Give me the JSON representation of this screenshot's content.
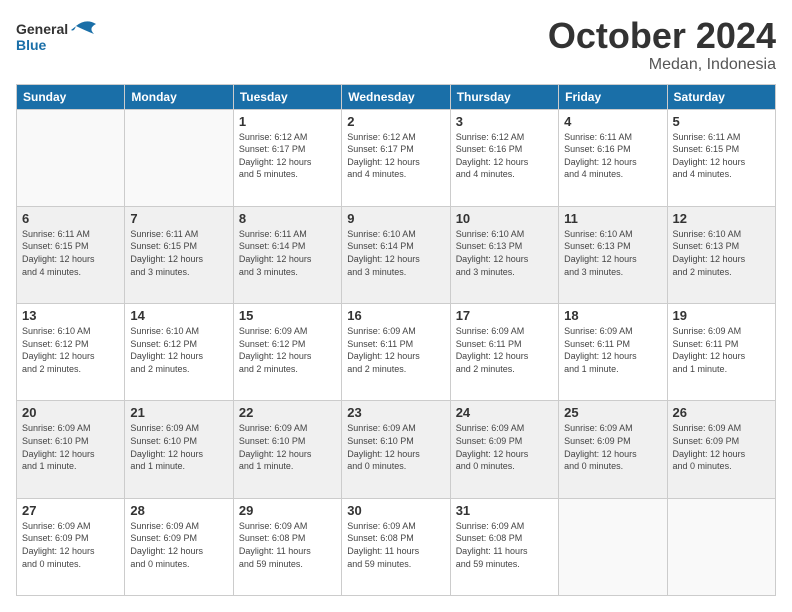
{
  "header": {
    "logo_line1": "General",
    "logo_line2": "Blue",
    "month": "October 2024",
    "location": "Medan, Indonesia"
  },
  "days_of_week": [
    "Sunday",
    "Monday",
    "Tuesday",
    "Wednesday",
    "Thursday",
    "Friday",
    "Saturday"
  ],
  "weeks": [
    [
      {
        "day": "",
        "info": ""
      },
      {
        "day": "",
        "info": ""
      },
      {
        "day": "1",
        "info": "Sunrise: 6:12 AM\nSunset: 6:17 PM\nDaylight: 12 hours\nand 5 minutes."
      },
      {
        "day": "2",
        "info": "Sunrise: 6:12 AM\nSunset: 6:17 PM\nDaylight: 12 hours\nand 4 minutes."
      },
      {
        "day": "3",
        "info": "Sunrise: 6:12 AM\nSunset: 6:16 PM\nDaylight: 12 hours\nand 4 minutes."
      },
      {
        "day": "4",
        "info": "Sunrise: 6:11 AM\nSunset: 6:16 PM\nDaylight: 12 hours\nand 4 minutes."
      },
      {
        "day": "5",
        "info": "Sunrise: 6:11 AM\nSunset: 6:15 PM\nDaylight: 12 hours\nand 4 minutes."
      }
    ],
    [
      {
        "day": "6",
        "info": "Sunrise: 6:11 AM\nSunset: 6:15 PM\nDaylight: 12 hours\nand 4 minutes."
      },
      {
        "day": "7",
        "info": "Sunrise: 6:11 AM\nSunset: 6:15 PM\nDaylight: 12 hours\nand 3 minutes."
      },
      {
        "day": "8",
        "info": "Sunrise: 6:11 AM\nSunset: 6:14 PM\nDaylight: 12 hours\nand 3 minutes."
      },
      {
        "day": "9",
        "info": "Sunrise: 6:10 AM\nSunset: 6:14 PM\nDaylight: 12 hours\nand 3 minutes."
      },
      {
        "day": "10",
        "info": "Sunrise: 6:10 AM\nSunset: 6:13 PM\nDaylight: 12 hours\nand 3 minutes."
      },
      {
        "day": "11",
        "info": "Sunrise: 6:10 AM\nSunset: 6:13 PM\nDaylight: 12 hours\nand 3 minutes."
      },
      {
        "day": "12",
        "info": "Sunrise: 6:10 AM\nSunset: 6:13 PM\nDaylight: 12 hours\nand 2 minutes."
      }
    ],
    [
      {
        "day": "13",
        "info": "Sunrise: 6:10 AM\nSunset: 6:12 PM\nDaylight: 12 hours\nand 2 minutes."
      },
      {
        "day": "14",
        "info": "Sunrise: 6:10 AM\nSunset: 6:12 PM\nDaylight: 12 hours\nand 2 minutes."
      },
      {
        "day": "15",
        "info": "Sunrise: 6:09 AM\nSunset: 6:12 PM\nDaylight: 12 hours\nand 2 minutes."
      },
      {
        "day": "16",
        "info": "Sunrise: 6:09 AM\nSunset: 6:11 PM\nDaylight: 12 hours\nand 2 minutes."
      },
      {
        "day": "17",
        "info": "Sunrise: 6:09 AM\nSunset: 6:11 PM\nDaylight: 12 hours\nand 2 minutes."
      },
      {
        "day": "18",
        "info": "Sunrise: 6:09 AM\nSunset: 6:11 PM\nDaylight: 12 hours\nand 1 minute."
      },
      {
        "day": "19",
        "info": "Sunrise: 6:09 AM\nSunset: 6:11 PM\nDaylight: 12 hours\nand 1 minute."
      }
    ],
    [
      {
        "day": "20",
        "info": "Sunrise: 6:09 AM\nSunset: 6:10 PM\nDaylight: 12 hours\nand 1 minute."
      },
      {
        "day": "21",
        "info": "Sunrise: 6:09 AM\nSunset: 6:10 PM\nDaylight: 12 hours\nand 1 minute."
      },
      {
        "day": "22",
        "info": "Sunrise: 6:09 AM\nSunset: 6:10 PM\nDaylight: 12 hours\nand 1 minute."
      },
      {
        "day": "23",
        "info": "Sunrise: 6:09 AM\nSunset: 6:10 PM\nDaylight: 12 hours\nand 0 minutes."
      },
      {
        "day": "24",
        "info": "Sunrise: 6:09 AM\nSunset: 6:09 PM\nDaylight: 12 hours\nand 0 minutes."
      },
      {
        "day": "25",
        "info": "Sunrise: 6:09 AM\nSunset: 6:09 PM\nDaylight: 12 hours\nand 0 minutes."
      },
      {
        "day": "26",
        "info": "Sunrise: 6:09 AM\nSunset: 6:09 PM\nDaylight: 12 hours\nand 0 minutes."
      }
    ],
    [
      {
        "day": "27",
        "info": "Sunrise: 6:09 AM\nSunset: 6:09 PM\nDaylight: 12 hours\nand 0 minutes."
      },
      {
        "day": "28",
        "info": "Sunrise: 6:09 AM\nSunset: 6:09 PM\nDaylight: 12 hours\nand 0 minutes."
      },
      {
        "day": "29",
        "info": "Sunrise: 6:09 AM\nSunset: 6:08 PM\nDaylight: 11 hours\nand 59 minutes."
      },
      {
        "day": "30",
        "info": "Sunrise: 6:09 AM\nSunset: 6:08 PM\nDaylight: 11 hours\nand 59 minutes."
      },
      {
        "day": "31",
        "info": "Sunrise: 6:09 AM\nSunset: 6:08 PM\nDaylight: 11 hours\nand 59 minutes."
      },
      {
        "day": "",
        "info": ""
      },
      {
        "day": "",
        "info": ""
      }
    ]
  ]
}
